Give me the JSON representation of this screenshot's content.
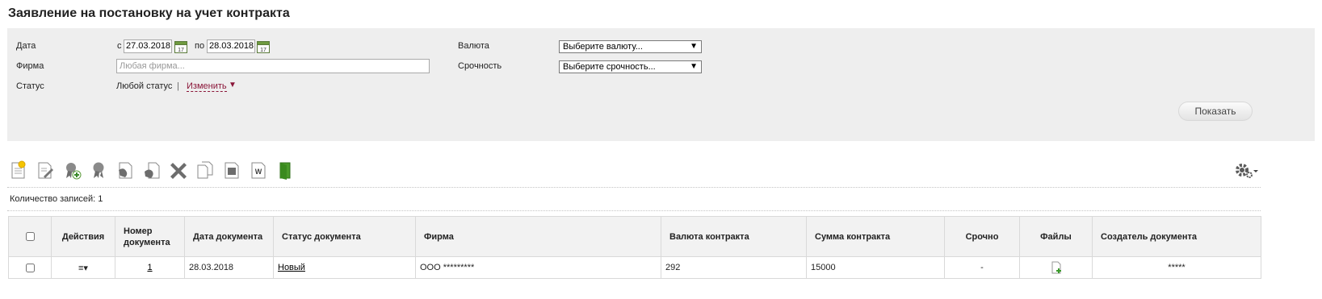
{
  "title": "Заявление на постановку на учет контракта",
  "filters": {
    "date_label": "Дата",
    "date_from_prefix": "с",
    "date_from": "27.03.2018",
    "date_to_prefix": "по",
    "date_to": "28.03.2018",
    "firm_label": "Фирма",
    "firm_placeholder": "Любая фирма...",
    "status_label": "Статус",
    "status_value": "Любой статус",
    "status_separator": "|",
    "status_change": "Изменить",
    "currency_label": "Валюта",
    "currency_value": "Выберите валюту...",
    "urgency_label": "Срочность",
    "urgency_value": "Выберите срочность...",
    "show_button": "Показать"
  },
  "toolbar": {
    "icons": [
      "new-document-icon",
      "edit-document-icon",
      "add-certificate-icon",
      "certificate-icon",
      "sign-document-icon",
      "sign-hand-icon",
      "delete-icon",
      "copy-icon",
      "print-icon",
      "export-word-icon",
      "exit-icon",
      "settings-gear-icon"
    ]
  },
  "records_count": "Количество записей: 1",
  "table": {
    "headers": {
      "actions": "Действия",
      "doc_number": "Номер документа",
      "doc_date": "Дата документа",
      "status": "Статус документа",
      "firm": "Фирма",
      "currency": "Валюта контракта",
      "amount": "Сумма контракта",
      "urgent": "Срочно",
      "files": "Файлы",
      "creator": "Создатель документа"
    },
    "rows": [
      {
        "actions_icon": "≡▾",
        "doc_number": "1",
        "doc_date": "28.03.2018",
        "status": "Новый",
        "firm": "ООО *********",
        "currency": "292",
        "amount": "15000",
        "urgent": "-",
        "creator": "*****"
      }
    ]
  }
}
